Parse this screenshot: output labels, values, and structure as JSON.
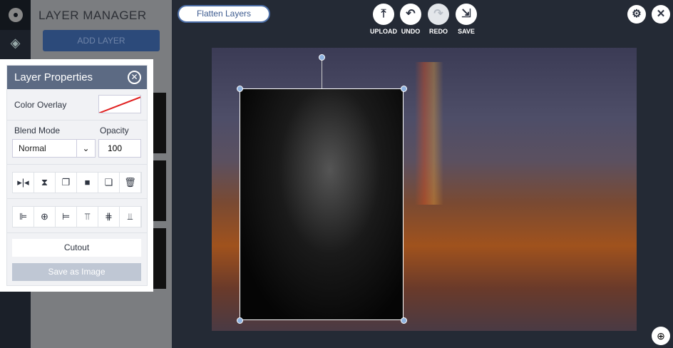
{
  "sidebar": {
    "logo": "b",
    "layers_icon": "layers-icon"
  },
  "layer_manager": {
    "title": "LAYER MANAGER",
    "add_layer": "ADD LAYER"
  },
  "toolbar": {
    "flatten": "Flatten Layers",
    "upload": "UPLOAD",
    "undo": "UNDO",
    "redo": "REDO",
    "save": "SAVE"
  },
  "props": {
    "title": "Layer Properties",
    "color_overlay": "Color Overlay",
    "blend_mode": "Blend Mode",
    "opacity": "Opacity",
    "blend_value": "Normal",
    "opacity_value": "100",
    "cutout": "Cutout",
    "save_image": "Save as Image"
  }
}
